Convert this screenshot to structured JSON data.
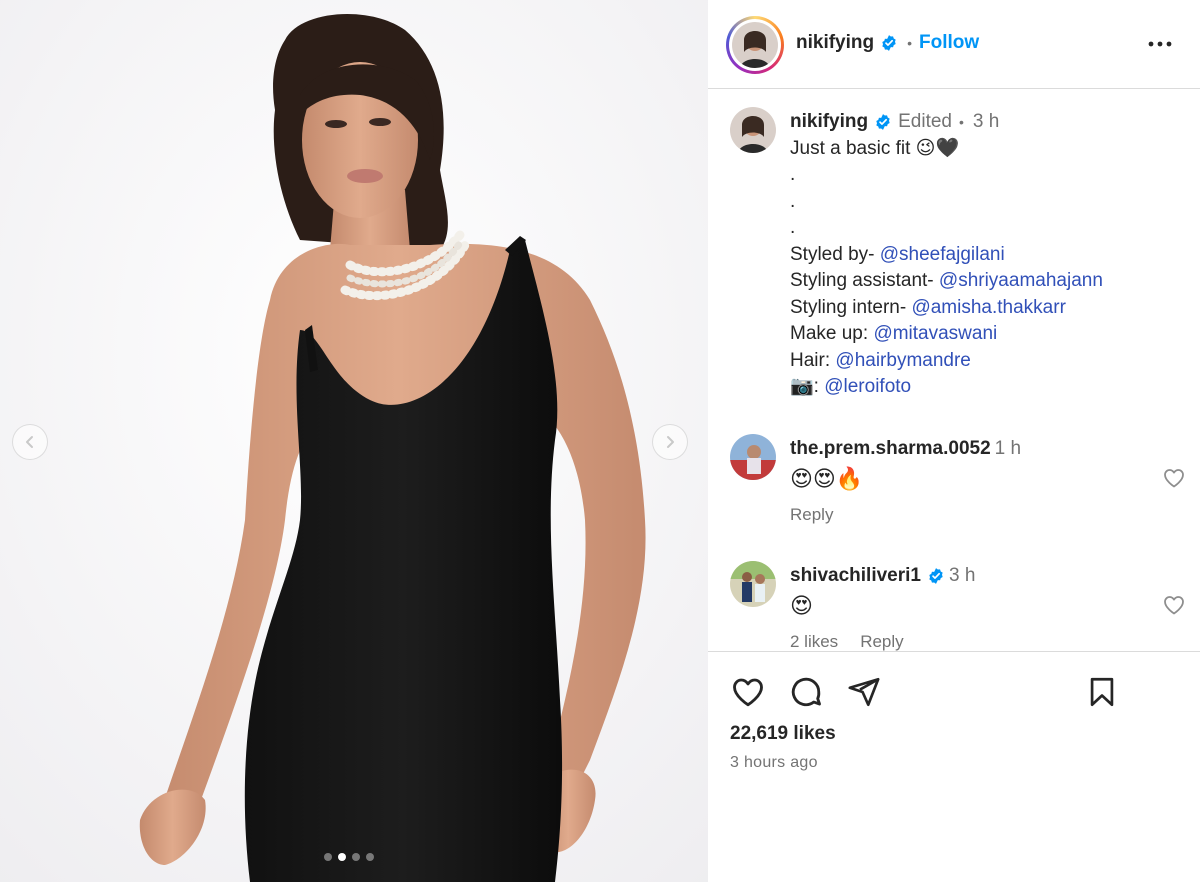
{
  "post": {
    "username": "nikifying",
    "follow_label": "Follow",
    "separator": "•"
  },
  "media": {
    "carousel_total": 4,
    "carousel_active": 2
  },
  "caption": {
    "username": "nikifying",
    "edited_label": "Edited",
    "time": "3 h",
    "line1": "Just a basic fit 😉🖤",
    "dots": [
      ".",
      ".",
      "."
    ],
    "credits": [
      {
        "label": "Styled by- ",
        "mention": "@sheefajgilani"
      },
      {
        "label": "Styling assistant- ",
        "mention": "@shriyaamahajann"
      },
      {
        "label": "Styling intern- ",
        "mention": "@amisha.thakkarr"
      },
      {
        "label": "Make up: ",
        "mention": "@mitavaswani"
      },
      {
        "label": "Hair: ",
        "mention": "@hairbymandre"
      },
      {
        "label": "📷: ",
        "mention": "@leroifoto"
      }
    ]
  },
  "comments": [
    {
      "username": "the.prem.sharma.0052",
      "time": "1 h",
      "text": "😍😍🔥",
      "likes": "",
      "reply": "Reply",
      "verified": false
    },
    {
      "username": "shivachiliveri1",
      "time": "3 h",
      "text": "😍",
      "likes": "2 likes",
      "reply": "Reply",
      "verified": true
    }
  ],
  "footer": {
    "likes": "22,619 likes",
    "time_ago": "3 hours ago"
  },
  "icons": {
    "like": "heart-icon",
    "comment": "comment-icon",
    "share": "share-icon",
    "save": "bookmark-icon",
    "more": "more-options-icon",
    "verified": "verified-badge-icon"
  },
  "colors": {
    "accent": "#0095f6",
    "verified": "#0095f6",
    "mention": "#3150b8",
    "muted": "#737373",
    "divider": "#dbdbdb"
  }
}
